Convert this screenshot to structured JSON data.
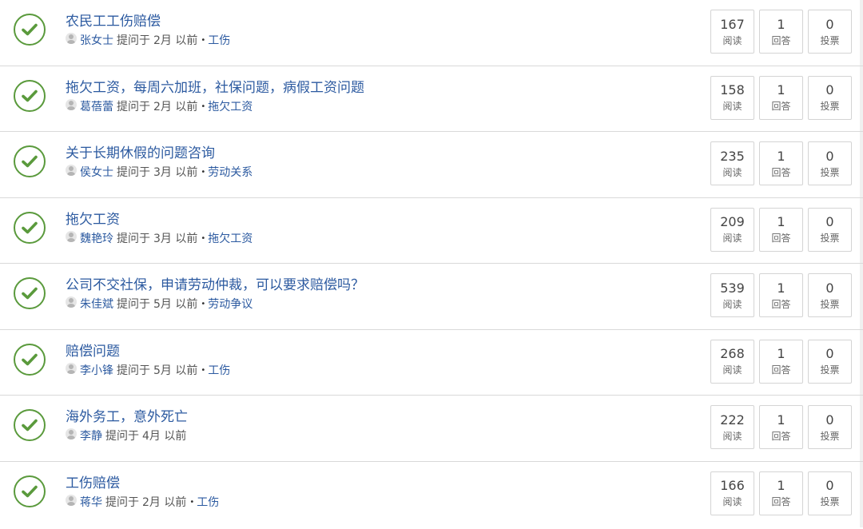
{
  "labels": {
    "asked": "提问于",
    "reads": "阅读",
    "answers": "回答",
    "votes": "投票",
    "bullet": "•"
  },
  "colors": {
    "accent": "#2c5aa0",
    "check": "#5a9a3c",
    "border": "#d9d9d9"
  },
  "questions": [
    {
      "title": "农民工工伤赔偿",
      "user": "张女士",
      "time": "2月 以前",
      "topic": "工伤",
      "reads": "167",
      "answers": "1",
      "votes": "0"
    },
    {
      "title": "拖欠工资，每周六加班，社保问题，病假工资问题",
      "user": "葛蓓蕾",
      "time": "2月 以前",
      "topic": "拖欠工资",
      "reads": "158",
      "answers": "1",
      "votes": "0"
    },
    {
      "title": "关于长期休假的问题咨询",
      "user": "侯女士",
      "time": "3月 以前",
      "topic": "劳动关系",
      "reads": "235",
      "answers": "1",
      "votes": "0"
    },
    {
      "title": "拖欠工资",
      "user": "魏艳玲",
      "time": "3月 以前",
      "topic": "拖欠工资",
      "reads": "209",
      "answers": "1",
      "votes": "0"
    },
    {
      "title": "公司不交社保，申请劳动仲裁，可以要求赔偿吗？",
      "user": "朱佳斌",
      "time": "5月 以前",
      "topic": "劳动争议",
      "reads": "539",
      "answers": "1",
      "votes": "0"
    },
    {
      "title": "赔偿问题",
      "user": "李小锋",
      "time": "5月 以前",
      "topic": "工伤",
      "reads": "268",
      "answers": "1",
      "votes": "0"
    },
    {
      "title": "海外务工，意外死亡",
      "user": "李静",
      "time": "4月 以前",
      "topic": "",
      "reads": "222",
      "answers": "1",
      "votes": "0"
    },
    {
      "title": "工伤赔偿",
      "user": "蒋华",
      "time": "2月 以前",
      "topic": "工伤",
      "reads": "166",
      "answers": "1",
      "votes": "0"
    }
  ]
}
